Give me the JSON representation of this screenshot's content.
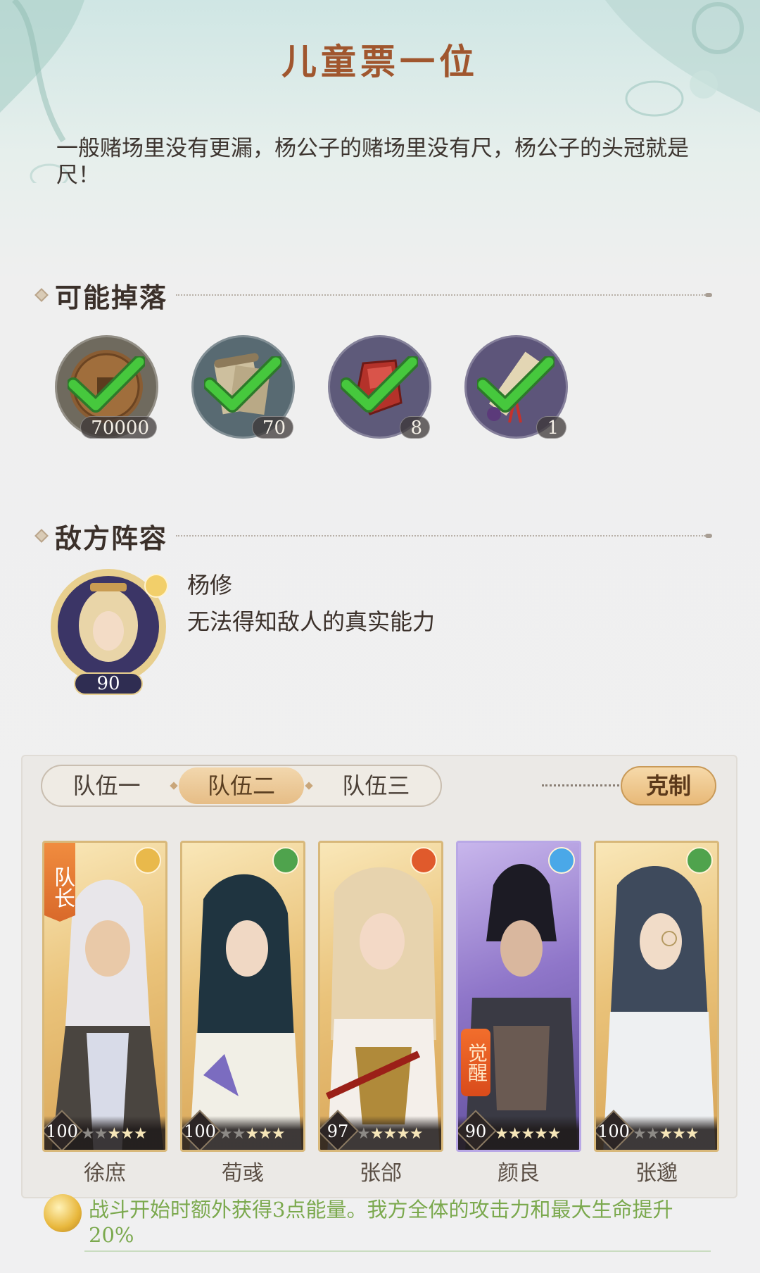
{
  "stage": {
    "title": "儿童票一位",
    "description": "一般赌场里没有更漏，杨公子的赌场里没有尺，杨公子的头冠就是尺！"
  },
  "drops": {
    "heading": "可能掉落",
    "items": [
      {
        "icon": "coin-icon",
        "count": "70000",
        "bg": "#6f6a5e"
      },
      {
        "icon": "scroll-paper-icon",
        "count": "70",
        "bg": "#586a72"
      },
      {
        "icon": "red-crystal-icon",
        "count": "8",
        "bg": "#5e5a7a"
      },
      {
        "icon": "sealed-scroll-icon",
        "count": "1",
        "bg": "#5d557a"
      }
    ]
  },
  "enemy": {
    "heading": "敌方阵容",
    "name": "杨修",
    "info": "无法得知敌人的真实能力",
    "level": "90"
  },
  "team": {
    "tabs": [
      {
        "label": "队伍一",
        "active": false
      },
      {
        "label": "队伍二",
        "active": true
      },
      {
        "label": "队伍三",
        "active": false
      }
    ],
    "counter_label": "克制",
    "leader_badge": "队长",
    "awaken_badge": "觉醒",
    "members": [
      {
        "name": "徐庶",
        "level": "100",
        "stars_lit": 3,
        "element": "moon",
        "rarity": "gold",
        "leader": true,
        "awakened": false
      },
      {
        "name": "荀彧",
        "level": "100",
        "stars_lit": 3,
        "element": "wind",
        "rarity": "gold",
        "leader": false,
        "awakened": false
      },
      {
        "name": "张郃",
        "level": "97",
        "stars_lit": 4,
        "element": "fire",
        "rarity": "gold",
        "leader": false,
        "awakened": false
      },
      {
        "name": "颜良",
        "level": "90",
        "stars_lit": 5,
        "element": "water",
        "rarity": "purple",
        "leader": false,
        "awakened": true
      },
      {
        "name": "张邈",
        "level": "100",
        "stars_lit": 3,
        "element": "wind",
        "rarity": "gold",
        "leader": false,
        "awakened": false
      }
    ]
  },
  "bonus": {
    "text": "战斗开始时额外获得3点能量。我方全体的攻击力和最大生命提升20%"
  },
  "colors": {
    "title": "#a0562e",
    "bonus_text": "#7ba94e",
    "tab_active": "#e6bd86",
    "gold_card": "#eac37a",
    "purple_card": "#8f76c9"
  }
}
